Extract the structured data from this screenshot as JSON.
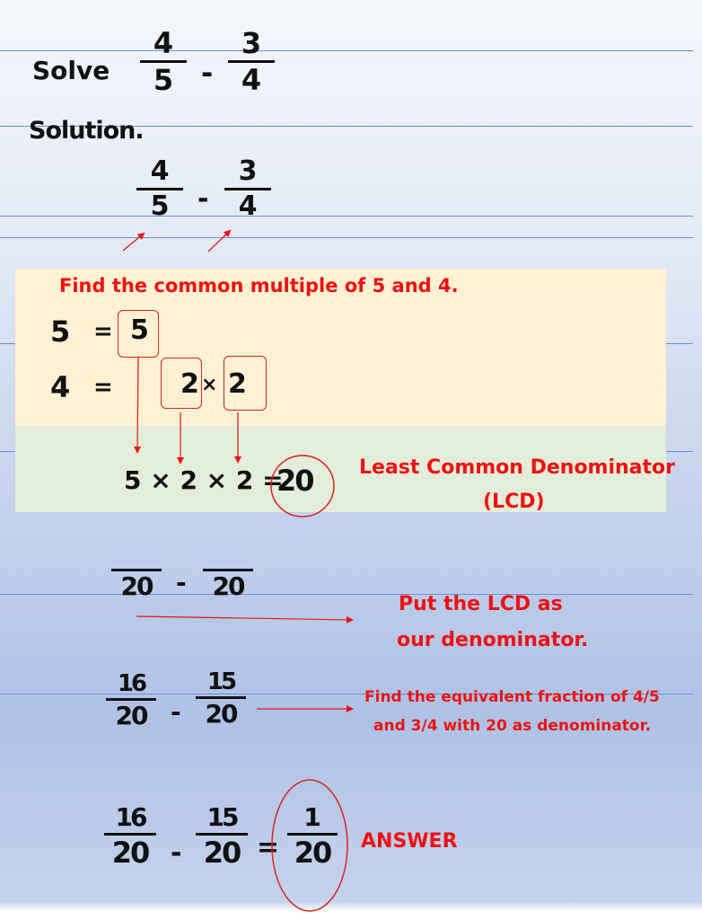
{
  "problem": {
    "label": "Solve",
    "fraction_a": {
      "numerator": "4",
      "denominator": "5"
    },
    "operator": "-",
    "fraction_b": {
      "numerator": "3",
      "denominator": "4"
    }
  },
  "solution": {
    "heading": "Solution.",
    "restated": {
      "fraction_a": {
        "numerator": "4",
        "denominator": "5"
      },
      "operator": "-",
      "fraction_b": {
        "numerator": "3",
        "denominator": "4"
      }
    }
  },
  "common_multiple": {
    "instruction": "Find the common multiple of 5 and 4.",
    "row1": {
      "left": "5",
      "equals": "=",
      "factor": "5"
    },
    "row2": {
      "left": "4",
      "equals": "=",
      "factor1": "2",
      "times": "×",
      "factor2": "2"
    },
    "product": {
      "expression": "5 × 2 × 2 =",
      "result": "20"
    },
    "lcd_label_line1": "Least Common Denominator",
    "lcd_label_line2": "(LCD)"
  },
  "step_lcd": {
    "denominator_a": "20",
    "operator": "-",
    "denominator_b": "20",
    "note_line1": "Put the LCD as",
    "note_line2": "our denominator."
  },
  "step_equivalent": {
    "fraction_a": {
      "numerator": "16",
      "denominator": "20"
    },
    "operator": "-",
    "fraction_b": {
      "numerator": "15",
      "denominator": "20"
    },
    "note_line1": "Find the equivalent fraction of 4/5",
    "note_line2": "and 3/4 with 20 as denominator."
  },
  "final": {
    "fraction_a": {
      "numerator": "16",
      "denominator": "20"
    },
    "operator": "-",
    "fraction_b": {
      "numerator": "15",
      "denominator": "20"
    },
    "equals": "=",
    "answer": {
      "numerator": "1",
      "denominator": "20"
    },
    "answer_label": "ANSWER"
  },
  "colors": {
    "annotation_red": "#ee1111",
    "rule_blue": "#6b8fd4",
    "panel_yellow": "#fff1d1",
    "panel_green": "#e2eed9"
  }
}
